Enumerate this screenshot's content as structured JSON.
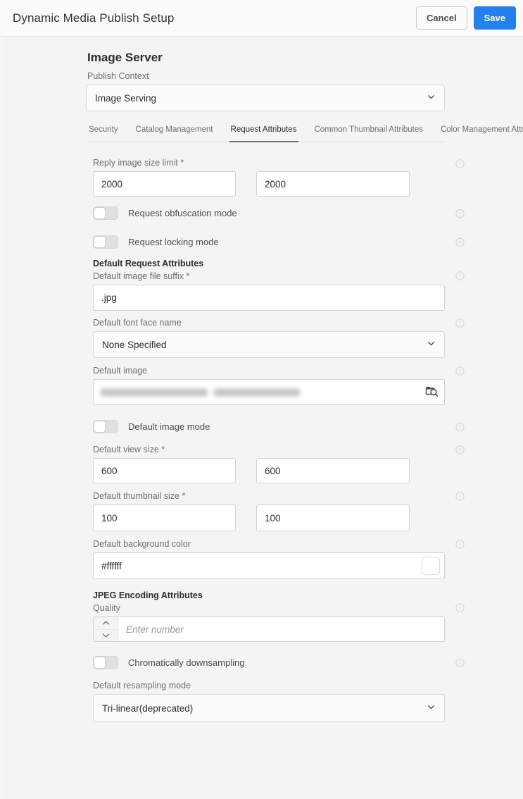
{
  "topbar": {
    "title": "Dynamic Media Publish Setup",
    "cancel_label": "Cancel",
    "save_label": "Save",
    "save_color": "#2680eb"
  },
  "section": {
    "title": "Image Server",
    "publish_context_label": "Publish Context",
    "publish_context_value": "Image Serving"
  },
  "tabs": [
    {
      "label": "Security",
      "active": false
    },
    {
      "label": "Catalog Management",
      "active": false
    },
    {
      "label": "Request Attributes",
      "active": true
    },
    {
      "label": "Common Thumbnail Attributes",
      "active": false
    },
    {
      "label": "Color Management Attributes",
      "active": false
    }
  ],
  "fields": {
    "reply_image_size_limit": {
      "label": "Reply image size limit *",
      "value_width": "2000",
      "value_height": "2000"
    },
    "request_obfuscation_mode": {
      "label": "Request obfuscation mode",
      "on": false
    },
    "request_locking_mode": {
      "label": "Request locking mode",
      "on": false
    },
    "default_request_attributes_heading": "Default Request Attributes",
    "default_image_file_suffix": {
      "label": "Default image file suffix *",
      "value": ".jpg"
    },
    "default_font_face_name": {
      "label": "Default font face name",
      "value": "None Specified"
    },
    "default_image": {
      "label": "Default image",
      "value": "",
      "redacted": true,
      "browse_icon": "folder-search-icon"
    },
    "default_image_mode": {
      "label": "Default image mode",
      "on": false
    },
    "default_view_size": {
      "label": "Default view size *",
      "value_width": "600",
      "value_height": "600"
    },
    "default_thumbnail_size": {
      "label": "Default thumbnail size *",
      "value_width": "100",
      "value_height": "100"
    },
    "default_background_color": {
      "label": "Default background color",
      "value": "#ffffff",
      "swatch_color": "#ffffff"
    },
    "jpeg_encoding_attributes_heading": "JPEG Encoding Attributes",
    "quality": {
      "label": "Quality",
      "value": "",
      "placeholder": "Enter number"
    },
    "chromatically_downsampling": {
      "label": "Chromatically downsampling",
      "on": false
    },
    "default_resampling_mode": {
      "label": "Default resampling mode",
      "value": "Tri-linear(deprecated)"
    }
  }
}
